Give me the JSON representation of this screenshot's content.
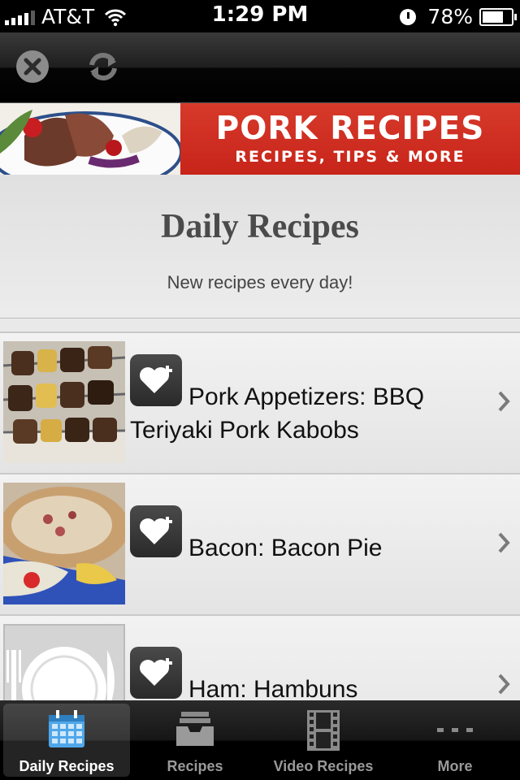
{
  "status_bar": {
    "carrier": "AT&T",
    "time": "1:29 PM",
    "battery": "78%",
    "battery_level": 0.78
  },
  "toolbar": {
    "close_icon": "close-icon",
    "refresh_icon": "refresh-icon"
  },
  "banner": {
    "title": "PORK RECIPES",
    "subtitle": "RECIPES, TIPS & MORE"
  },
  "header": {
    "title": "Daily Recipes",
    "subtitle": "New recipes every day!"
  },
  "recipes": [
    {
      "title": "Pork Appetizers: BBQ Teriyaki Pork Kabobs",
      "thumb": "kabobs"
    },
    {
      "title": "Bacon: Bacon Pie",
      "thumb": "pie"
    },
    {
      "title": "Ham: Hambuns",
      "thumb": "placeholder-plate"
    }
  ],
  "tabs": [
    {
      "label": "Daily Recipes",
      "icon": "calendar-icon",
      "active": true
    },
    {
      "label": "Recipes",
      "icon": "inbox-tray-icon",
      "active": false
    },
    {
      "label": "Video Recipes",
      "icon": "film-strip-icon",
      "active": false
    },
    {
      "label": "More",
      "icon": "more-dots-icon",
      "active": false
    }
  ],
  "colors": {
    "banner_red": "#c8241a",
    "tab_active_blue": "#5ab0ef"
  }
}
